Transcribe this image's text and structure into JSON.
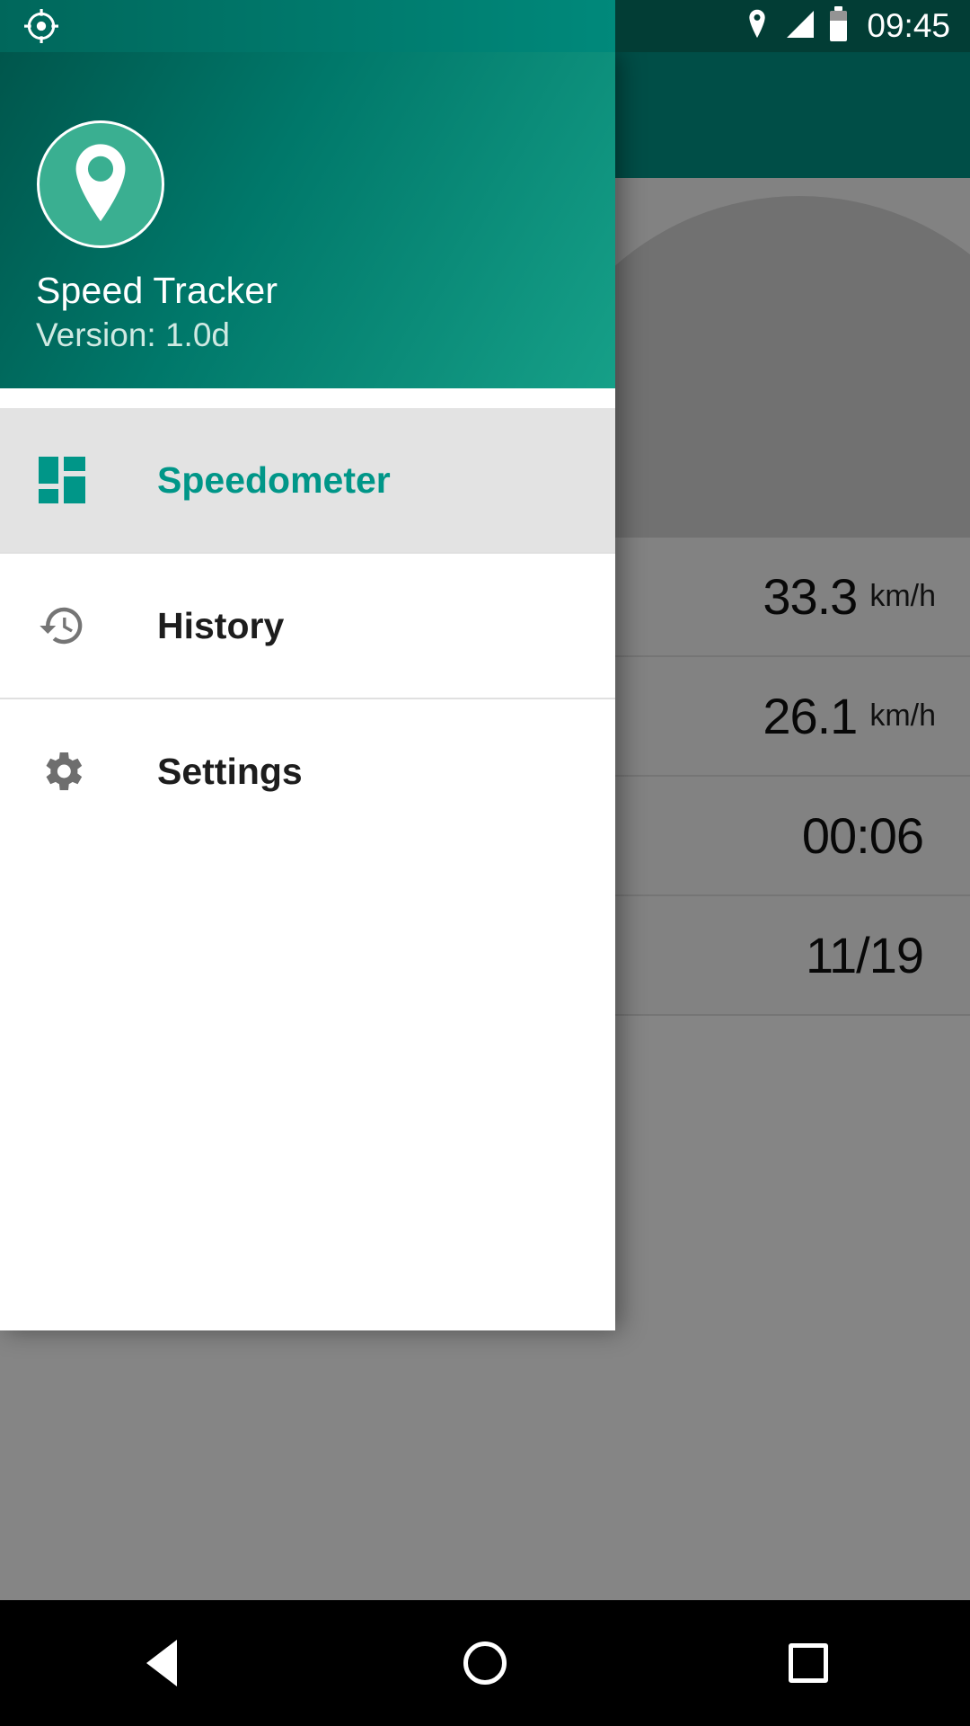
{
  "status_bar": {
    "clock": "09:45",
    "icons": [
      "location-pin-icon",
      "signal-icon",
      "battery-icon"
    ],
    "gps_icon": "gps-crosshair-icon"
  },
  "drawer": {
    "header": {
      "logo_icon": "map-pin-logo-icon",
      "app_name": "Speed Tracker",
      "version": "Version: 1.0d"
    },
    "items": [
      {
        "label": "Speedometer",
        "icon": "dashboard-grid-icon",
        "selected": true
      },
      {
        "label": "History",
        "icon": "history-clock-icon",
        "selected": false
      },
      {
        "label": "Settings",
        "icon": "gear-icon",
        "selected": false
      }
    ]
  },
  "background": {
    "rows": [
      {
        "value": "33.3",
        "unit": "km/h"
      },
      {
        "value": "26.1",
        "unit": "km/h"
      },
      {
        "value": "00:06",
        "unit": ""
      },
      {
        "value": "11/19",
        "unit": ""
      }
    ]
  },
  "nav_bar": {
    "back_label": "back-button",
    "home_label": "home-button",
    "recents_label": "recents-button"
  },
  "colors": {
    "accent": "#009688",
    "header_dark": "#00564c",
    "header_light": "#16a088",
    "selected_row": "#e3e3e3"
  }
}
